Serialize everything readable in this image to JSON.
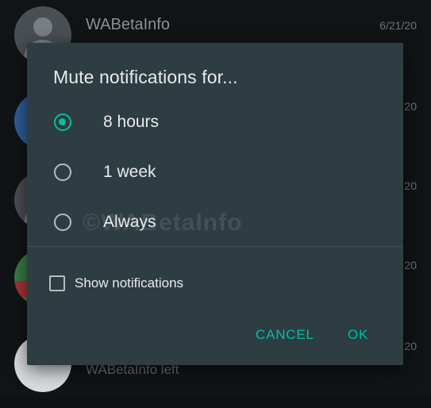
{
  "background_list": {
    "rows": [
      {
        "name": "WABetaInfo",
        "date": "6/21/20"
      },
      {
        "date": "20"
      },
      {
        "date": "20"
      },
      {
        "date": "20"
      },
      {
        "date": "20",
        "subtitle": "WABetaInfo left"
      }
    ]
  },
  "dialog": {
    "title": "Mute notifications for...",
    "options": [
      {
        "label": "8 hours",
        "selected": true
      },
      {
        "label": "1 week",
        "selected": false
      },
      {
        "label": "Always",
        "selected": false
      }
    ],
    "watermark": "©WABetaInfo",
    "show_notifications": {
      "label": "Show notifications",
      "checked": false
    },
    "cancel_label": "CANCEL",
    "ok_label": "OK"
  },
  "colors": {
    "accent": "#00bfa5",
    "dialog_bg": "#2e3d42",
    "text": "#e7ebec"
  },
  "icons": {
    "avatar": "default-avatar-icon",
    "radio_on": "radio-checked-icon",
    "radio_off": "radio-unchecked-icon",
    "checkbox": "checkbox-unchecked-icon"
  }
}
